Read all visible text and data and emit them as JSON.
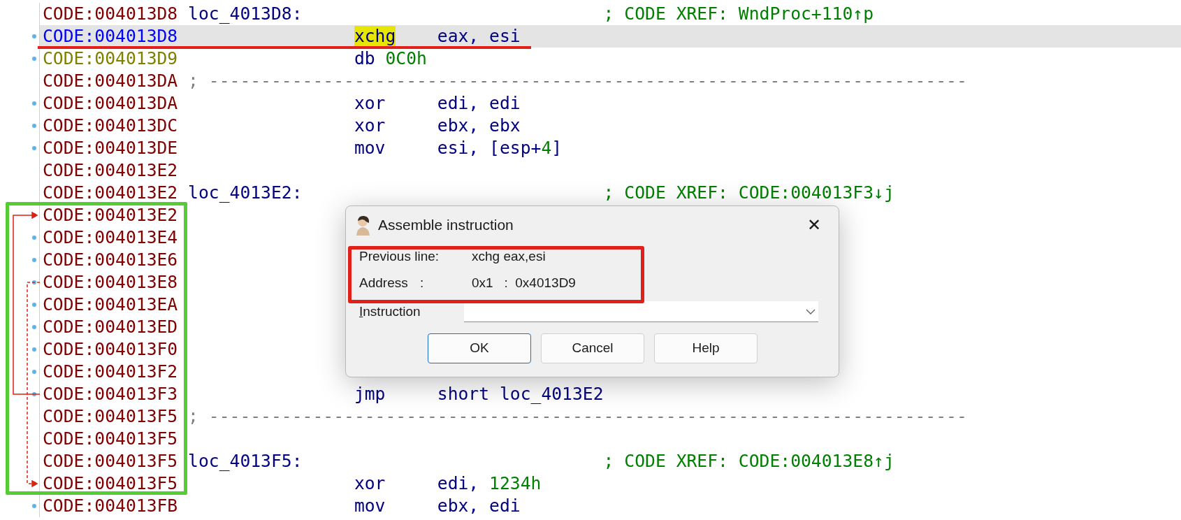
{
  "listing": {
    "lines": [
      {
        "address": "CODE:004013D8",
        "color": "#800000",
        "dot": false,
        "selected": false,
        "kind": "label",
        "label": "loc_4013D8:",
        "comment": "; CODE XREF: WndProc+110↑p"
      },
      {
        "address": "CODE:004013D8",
        "color": "#0000ff",
        "dot": true,
        "selected": true,
        "kind": "instr",
        "mnemonic": "xchg",
        "mnemonic_highlighted": true,
        "operands": [
          {
            "text": "eax, esi",
            "kind": "reg"
          }
        ]
      },
      {
        "address": "CODE:004013D9",
        "color": "#808000",
        "dot": true,
        "selected": false,
        "kind": "data",
        "mnemonic": "db",
        "mnemonic_highlighted": false,
        "operands": [
          {
            "text": "0C0h",
            "kind": "number"
          }
        ]
      },
      {
        "address": "CODE:004013DA",
        "color": "#800000",
        "dot": false,
        "selected": false,
        "kind": "separator",
        "text": "; -------------------------------------------------------------------------"
      },
      {
        "address": "CODE:004013DA",
        "color": "#800000",
        "dot": true,
        "selected": false,
        "kind": "instr",
        "mnemonic": "xor",
        "mnemonic_highlighted": false,
        "operands": [
          {
            "text": "edi, edi",
            "kind": "reg"
          }
        ]
      },
      {
        "address": "CODE:004013DC",
        "color": "#800000",
        "dot": true,
        "selected": false,
        "kind": "instr",
        "mnemonic": "xor",
        "mnemonic_highlighted": false,
        "operands": [
          {
            "text": "ebx, ebx",
            "kind": "reg"
          }
        ]
      },
      {
        "address": "CODE:004013DE",
        "color": "#800000",
        "dot": true,
        "selected": false,
        "kind": "instr",
        "mnemonic": "mov",
        "mnemonic_highlighted": false,
        "operands": [
          {
            "text": "esi, [esp+",
            "kind": "reg"
          },
          {
            "text": "4",
            "kind": "number"
          },
          {
            "text": "]",
            "kind": "reg"
          }
        ]
      },
      {
        "address": "CODE:004013E2",
        "color": "#800000",
        "dot": false,
        "selected": false,
        "kind": "blank"
      },
      {
        "address": "CODE:004013E2",
        "color": "#800000",
        "dot": false,
        "selected": false,
        "kind": "label",
        "label": "loc_4013E2:",
        "comment": "; CODE XREF: CODE:004013F3↓j"
      },
      {
        "address": "CODE:004013E2",
        "color": "#800000",
        "dot": true,
        "selected": false,
        "kind": "blank"
      },
      {
        "address": "CODE:004013E4",
        "color": "#800000",
        "dot": true,
        "selected": false,
        "kind": "blank"
      },
      {
        "address": "CODE:004013E6",
        "color": "#800000",
        "dot": true,
        "selected": false,
        "kind": "blank"
      },
      {
        "address": "CODE:004013E8",
        "color": "#800000",
        "dot": true,
        "selected": false,
        "kind": "blank"
      },
      {
        "address": "CODE:004013EA",
        "color": "#800000",
        "dot": true,
        "selected": false,
        "kind": "blank"
      },
      {
        "address": "CODE:004013ED",
        "color": "#800000",
        "dot": true,
        "selected": false,
        "kind": "blank"
      },
      {
        "address": "CODE:004013F0",
        "color": "#800000",
        "dot": true,
        "selected": false,
        "kind": "blank"
      },
      {
        "address": "CODE:004013F2",
        "color": "#800000",
        "dot": true,
        "selected": false,
        "kind": "blank"
      },
      {
        "address": "CODE:004013F3",
        "color": "#800000",
        "dot": true,
        "selected": false,
        "kind": "instr",
        "mnemonic": "jmp",
        "mnemonic_highlighted": false,
        "operands": [
          {
            "text": "short loc_4013E2",
            "kind": "reg"
          }
        ]
      },
      {
        "address": "CODE:004013F5",
        "color": "#800000",
        "dot": false,
        "selected": false,
        "kind": "separator",
        "text": "; -------------------------------------------------------------------------"
      },
      {
        "address": "CODE:004013F5",
        "color": "#800000",
        "dot": false,
        "selected": false,
        "kind": "blank"
      },
      {
        "address": "CODE:004013F5",
        "color": "#800000",
        "dot": false,
        "selected": false,
        "kind": "label",
        "label": "loc_4013F5:",
        "comment": "; CODE XREF: CODE:004013E8↑j"
      },
      {
        "address": "CODE:004013F5",
        "color": "#800000",
        "dot": true,
        "selected": false,
        "kind": "instr",
        "mnemonic": "xor",
        "mnemonic_highlighted": false,
        "operands": [
          {
            "text": "edi, ",
            "kind": "reg"
          },
          {
            "text": "1234h",
            "kind": "number"
          }
        ]
      },
      {
        "address": "CODE:004013FB",
        "color": "#800000",
        "dot": true,
        "selected": false,
        "kind": "instr",
        "mnemonic": "mov",
        "mnemonic_highlighted": false,
        "operands": [
          {
            "text": "ebx, edi",
            "kind": "reg"
          }
        ]
      }
    ]
  },
  "annotations": [
    {
      "kind": "underline"
    },
    {
      "kind": "address-box"
    },
    {
      "kind": "info-box"
    }
  ],
  "dialog": {
    "title": "Assemble instruction",
    "close": "✕",
    "info": [
      {
        "label": "Previous line:",
        "value": "xchg eax,esi"
      },
      {
        "label": "Address",
        "colon": ":",
        "value": "0x1   :  0x4013D9"
      }
    ],
    "instruction": {
      "label": "Instruction",
      "underline_first": true
    },
    "buttons": [
      {
        "label": "OK",
        "default": true
      },
      {
        "label": "Cancel",
        "default": false
      },
      {
        "label": "Help",
        "default": false
      }
    ]
  }
}
